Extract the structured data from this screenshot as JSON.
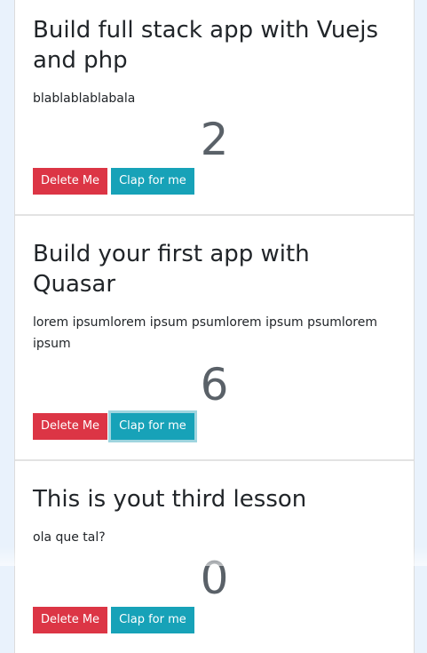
{
  "lessons": [
    {
      "title": "Build full stack app with Vuejs and php",
      "body": "blablablablabala",
      "claps": "2",
      "delete_label": "Delete Me",
      "clap_label": "Clap for me"
    },
    {
      "title": "Build your first app with Quasar",
      "body": "lorem ipsumlorem ipsum psumlorem ipsum psumlorem ipsum",
      "claps": "6",
      "delete_label": "Delete Me",
      "clap_label": "Clap for me"
    },
    {
      "title": "This is yout third lesson",
      "body": "ola que tal?",
      "claps": "0",
      "delete_label": "Delete Me",
      "clap_label": "Clap for me"
    }
  ],
  "colors": {
    "delete": "#dc3545",
    "clap": "#17a2b8",
    "count": "#5a6168"
  }
}
